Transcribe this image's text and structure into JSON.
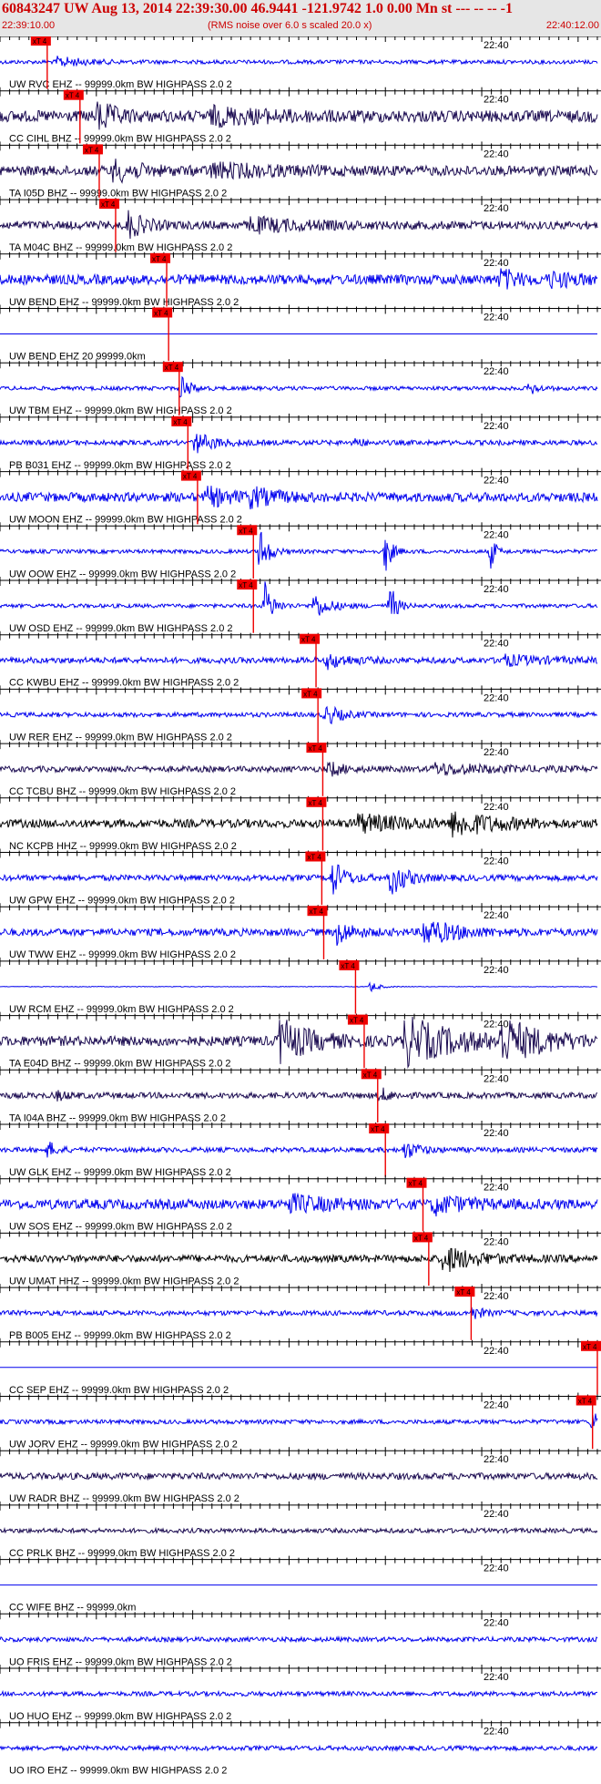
{
  "header": {
    "title": "60843247 UW Aug 13, 2014 22:39:30.00   46.9441 -121.9742  1.0 0.00 Mn st --- -- --   -1",
    "start_time": "22:39:10.00",
    "note": "(RMS noise over 6.0 s scaled 20.0 x)",
    "end_time": "22:40:12.00"
  },
  "chart_data": {
    "type": "line",
    "title": "60843247 UW Aug 13, 2014 22:39:30.00   46.9441 -121.9742  1.0 0.00 Mn st --- -- --   -1",
    "x_range_seconds": [
      0,
      62
    ],
    "minute_mark_label": "22:40",
    "minute_mark_second": 50,
    "pick_label": "xT 4",
    "colors": {
      "blue": "#0000ee",
      "dark": "#1a0a50",
      "black": "#000000",
      "pick": "#ee0000",
      "tick": "#000000"
    },
    "traces": [
      {
        "label": "UW RVC EHZ -- 99999.0km BW  HIGHPASS  2.0  2",
        "color": "blue",
        "amp": 0.12,
        "pick_s": 4.9,
        "bursts": [
          {
            "t": 6,
            "a": 0.3,
            "d": 2.5
          }
        ]
      },
      {
        "label": "CC CIHL BHZ -- 99999.0km BW  HIGHPASS  2.0  2",
        "color": "dark",
        "amp": 0.35,
        "pick_s": 8.3,
        "bursts": [
          {
            "t": 10.2,
            "a": 0.9,
            "d": 1.5
          },
          {
            "t": 22,
            "a": 0.4,
            "d": 6
          }
        ]
      },
      {
        "label": "TA I05D BHZ -- 99999.0km BW  HIGHPASS  2.0  2",
        "color": "dark",
        "amp": 0.3,
        "pick_s": 10.3,
        "bursts": [
          {
            "t": 11.8,
            "a": 0.6,
            "d": 2.5
          },
          {
            "t": 22,
            "a": 0.35,
            "d": 6
          }
        ]
      },
      {
        "label": "TA M04C BHZ -- 99999.0km BW  HIGHPASS  2.0  2",
        "color": "dark",
        "amp": 0.25,
        "pick_s": 12.0,
        "bursts": [
          {
            "t": 13.3,
            "a": 0.8,
            "d": 1.5
          },
          {
            "t": 26,
            "a": 0.4,
            "d": 5
          }
        ]
      },
      {
        "label": "UW BEND EHZ -- 99999.0km BW  HIGHPASS  2.0  2",
        "color": "blue",
        "amp": 0.3,
        "pick_s": 17.3,
        "bursts": [
          {
            "t": 52,
            "a": 0.6,
            "d": 1.5
          },
          {
            "t": 57,
            "a": 0.35,
            "d": 3
          }
        ]
      },
      {
        "label": "UW BEND EHZ 20 99999.0km",
        "color": "blue",
        "amp": 0,
        "pick_s": 17.5,
        "bursts": []
      },
      {
        "label": "UW TBM EHZ -- 99999.0km BW  HIGHPASS  2.0  2",
        "color": "blue",
        "amp": 0.12,
        "pick_s": 18.6,
        "bursts": [
          {
            "t": 18.8,
            "a": 0.9,
            "d": 0.8
          },
          {
            "t": 55,
            "a": 0.4,
            "d": 0.8
          }
        ]
      },
      {
        "label": "PB B031 EHZ -- 99999.0km BW  HIGHPASS  2.0  2",
        "color": "blue",
        "amp": 0.15,
        "pick_s": 19.5,
        "bursts": [
          {
            "t": 20.2,
            "a": 0.6,
            "d": 2
          },
          {
            "t": 37,
            "a": 0.4,
            "d": 0.5
          }
        ]
      },
      {
        "label": "UW MOON EHZ -- 99999.0km BW  HIGHPASS  2.0  2",
        "color": "blue",
        "amp": 0.28,
        "pick_s": 20.5,
        "bursts": [
          {
            "t": 21.5,
            "a": 0.5,
            "d": 2.5
          },
          {
            "t": 26,
            "a": 0.45,
            "d": 2.5
          }
        ]
      },
      {
        "label": "UW OOW EHZ -- 99999.0km BW  HIGHPASS  2.0  2",
        "color": "blue",
        "amp": 0.12,
        "pick_s": 26.3,
        "bursts": [
          {
            "t": 27,
            "a": 1.5,
            "d": 0.8
          },
          {
            "t": 40,
            "a": 1.4,
            "d": 0.6
          },
          {
            "t": 51,
            "a": 1.2,
            "d": 0.4
          },
          {
            "t": 64,
            "a": 1.5,
            "d": 0.5
          }
        ]
      },
      {
        "label": "UW OSD EHZ -- 99999.0km BW  HIGHPASS  2.0  2",
        "color": "blue",
        "amp": 0.12,
        "pick_s": 26.3,
        "bursts": [
          {
            "t": 27.5,
            "a": 1.4,
            "d": 0.8
          },
          {
            "t": 32.5,
            "a": 0.8,
            "d": 1.5
          },
          {
            "t": 40.5,
            "a": 1.4,
            "d": 0.6
          },
          {
            "t": 63.5,
            "a": 1.2,
            "d": 0.5
          }
        ]
      },
      {
        "label": "CC KWBU EHZ -- 99999.0km BW  HIGHPASS  2.0  2",
        "color": "blue",
        "amp": 0.18,
        "pick_s": 32.8,
        "bursts": [
          {
            "t": 34,
            "a": 0.45,
            "d": 2
          },
          {
            "t": 52,
            "a": 0.3,
            "d": 4
          }
        ]
      },
      {
        "label": "UW RER EHZ -- 99999.0km BW  HIGHPASS  2.0  2",
        "color": "blue",
        "amp": 0.14,
        "pick_s": 33.0,
        "bursts": [
          {
            "t": 33.8,
            "a": 0.6,
            "d": 1.5
          }
        ]
      },
      {
        "label": "CC TCBU BHZ -- 99999.0km BW  HIGHPASS  2.0  2",
        "color": "dark",
        "amp": 0.18,
        "pick_s": 33.5,
        "bursts": [
          {
            "t": 34.2,
            "a": 0.45,
            "d": 1.2
          },
          {
            "t": 45,
            "a": 0.3,
            "d": 6
          }
        ]
      },
      {
        "label": "NC KCPB HHZ -- 99999.0km BW  HIGHPASS  2.0  2",
        "color": "black",
        "amp": 0.25,
        "pick_s": 33.5,
        "bursts": [
          {
            "t": 37,
            "a": 0.5,
            "d": 5
          },
          {
            "t": 47,
            "a": 0.7,
            "d": 4
          }
        ]
      },
      {
        "label": "UW GPW EHZ -- 99999.0km BW  HIGHPASS  2.0  2",
        "color": "blue",
        "amp": 0.18,
        "pick_s": 33.4,
        "bursts": [
          {
            "t": 34.5,
            "a": 1.1,
            "d": 1.2
          },
          {
            "t": 40.5,
            "a": 1.1,
            "d": 1.5
          }
        ]
      },
      {
        "label": "UW TWW EHZ -- 99999.0km BW  HIGHPASS  2.0  2",
        "color": "blue",
        "amp": 0.22,
        "pick_s": 33.6,
        "bursts": [
          {
            "t": 35,
            "a": 0.7,
            "d": 1.5
          },
          {
            "t": 44,
            "a": 0.8,
            "d": 3
          }
        ]
      },
      {
        "label": "UW RCM EHZ -- 99999.0km BW  HIGHPASS  2.0  2",
        "color": "blue",
        "amp": 0.02,
        "pick_s": 36.9,
        "bursts": [
          {
            "t": 38.5,
            "a": 0.35,
            "d": 0.8
          }
        ]
      },
      {
        "label": "TA E04D BHZ -- 99999.0km BW  HIGHPASS  2.0  2",
        "color": "dark",
        "amp": 0.3,
        "pick_s": 37.8,
        "bursts": [
          {
            "t": 29,
            "a": 1.3,
            "d": 3
          },
          {
            "t": 42,
            "a": 1.4,
            "d": 5
          },
          {
            "t": 52,
            "a": 1.2,
            "d": 4
          }
        ]
      },
      {
        "label": "TA I04A BHZ -- 99999.0km BW  HIGHPASS  2.0  2",
        "color": "dark",
        "amp": 0.18,
        "pick_s": 39.2,
        "bursts": [
          {
            "t": 39.5,
            "a": 0.4,
            "d": 1
          },
          {
            "t": 6,
            "a": 0.25,
            "d": 1
          }
        ]
      },
      {
        "label": "UW GLK EHZ -- 99999.0km BW  HIGHPASS  2.0  2",
        "color": "blue",
        "amp": 0.15,
        "pick_s": 40.0,
        "bursts": [
          {
            "t": 5,
            "a": 0.5,
            "d": 0.8
          },
          {
            "t": 42,
            "a": 0.5,
            "d": 1.5
          }
        ]
      },
      {
        "label": "UW SOS EHZ -- 99999.0km BW  HIGHPASS  2.0  2",
        "color": "blue",
        "amp": 0.3,
        "pick_s": 43.9,
        "bursts": [
          {
            "t": 45,
            "a": 0.5,
            "d": 3
          },
          {
            "t": 30,
            "a": 0.45,
            "d": 4
          }
        ]
      },
      {
        "label": "UW UMAT HHZ -- 99999.0km BW  HIGHPASS  2.0  2",
        "color": "black",
        "amp": 0.22,
        "pick_s": 44.5,
        "bursts": [
          {
            "t": 46,
            "a": 0.8,
            "d": 3
          }
        ]
      },
      {
        "label": "PB B005 EHZ -- 99999.0km BW  HIGHPASS  2.0  2",
        "color": "blue",
        "amp": 0.15,
        "pick_s": 48.9,
        "bursts": [
          {
            "t": 49,
            "a": 0.4,
            "d": 1
          }
        ]
      },
      {
        "label": "CC SEP EHZ -- 99999.0km BW  HIGHPASS  2.0  2",
        "color": "blue",
        "amp": 0.0,
        "pick_s": 62.0,
        "bursts": []
      },
      {
        "label": "UW JORV EHZ -- 99999.0km BW  HIGHPASS  2.0  2",
        "color": "blue",
        "amp": 0.13,
        "pick_s": 61.5,
        "bursts": [
          {
            "t": 61.5,
            "a": 0.7,
            "d": 0.8
          }
        ]
      },
      {
        "label": "UW RADR BHZ -- 99999.0km BW  HIGHPASS  2.0  2",
        "color": "dark",
        "amp": 0.2,
        "pick_s": null,
        "bursts": []
      },
      {
        "label": "CC PRLK BHZ -- 99999.0km BW  HIGHPASS  2.0  2",
        "color": "dark",
        "amp": 0.14,
        "pick_s": null,
        "bursts": []
      },
      {
        "label": "CC WIFE BHZ -- 99999.0km",
        "color": "blue",
        "amp": 0,
        "pick_s": null,
        "bursts": []
      },
      {
        "label": "UO FRIS EHZ -- 99999.0km BW  HIGHPASS  2.0  2",
        "color": "blue",
        "amp": 0.14,
        "pick_s": null,
        "bursts": []
      },
      {
        "label": "UO HUO EHZ -- 99999.0km BW  HIGHPASS  2.0  2",
        "color": "blue",
        "amp": 0.14,
        "pick_s": null,
        "bursts": []
      },
      {
        "label": "UO IRO EHZ -- 99999.0km BW  HIGHPASS  2.0  2",
        "color": "blue",
        "amp": 0.14,
        "pick_s": null,
        "bursts": []
      }
    ]
  }
}
